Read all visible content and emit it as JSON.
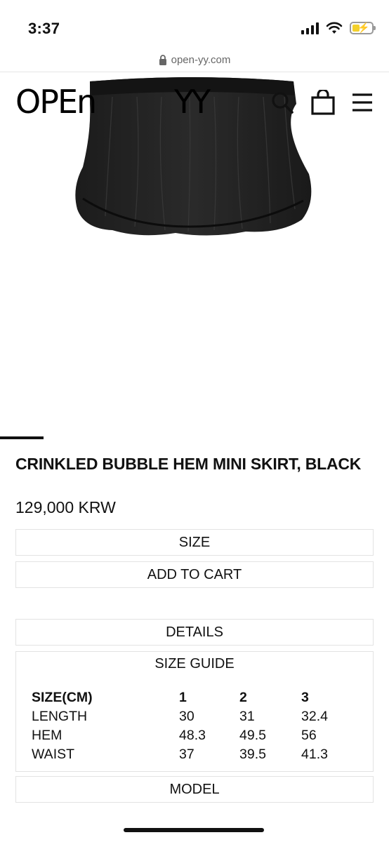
{
  "status_bar": {
    "time": "3:37"
  },
  "browser": {
    "url": "open-yy.com"
  },
  "header": {
    "logo_left": "OPEn",
    "logo_right": "YY"
  },
  "product": {
    "title": "CRINKLED BUBBLE HEM MINI SKIRT, BLACK",
    "price": "129,000 KRW"
  },
  "buttons": {
    "size": "SIZE",
    "add_to_cart": "ADD TO CART",
    "details": "DETAILS",
    "model": "MODEL"
  },
  "size_guide": {
    "title": "SIZE GUIDE",
    "headers": [
      "SIZE(CM)",
      "1",
      "2",
      "3"
    ],
    "rows": [
      [
        "LENGTH",
        "30",
        "31",
        "32.4"
      ],
      [
        "HEM",
        "48.3",
        "49.5",
        "56"
      ],
      [
        "WAIST",
        "37",
        "39.5",
        "41.3"
      ]
    ]
  },
  "colors": {
    "text": "#111111",
    "border": "#e3e3e3",
    "battery": "#f3d02c"
  }
}
